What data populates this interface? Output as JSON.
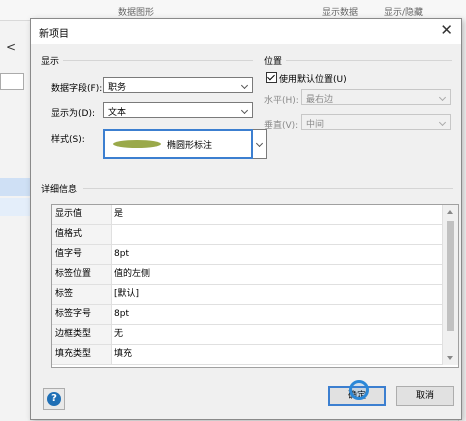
{
  "background": {
    "header_cols": [
      "数据图形",
      "显示数据",
      "显示/隐藏"
    ],
    "left_glyph": "<"
  },
  "dialog": {
    "title": "新项目",
    "close_glyph": "✕",
    "display_group": "显示",
    "data_field_label": "数据字段(F):",
    "data_field_value": "职务",
    "display_as_label": "显示为(D):",
    "display_as_value": "文本",
    "style_label": "样式(S):",
    "style_value": "椭圆形标注",
    "position_group": "位置",
    "use_default_position_label": "使用默认位置(U)",
    "use_default_position_checked": true,
    "horizontal_label": "水平(H):",
    "horizontal_value": "最右边",
    "vertical_label": "垂直(V):",
    "vertical_value": "中间",
    "details_group": "详细信息",
    "details": [
      {
        "key": "显示值",
        "value": "是"
      },
      {
        "key": "值格式",
        "value": ""
      },
      {
        "key": "值字号",
        "value": "8pt"
      },
      {
        "key": "标签位置",
        "value": "值的左侧"
      },
      {
        "key": "标签",
        "value": "[默认]"
      },
      {
        "key": "标签字号",
        "value": "8pt"
      },
      {
        "key": "边框类型",
        "value": "无"
      },
      {
        "key": "填充类型",
        "value": "填充"
      }
    ],
    "help_glyph": "?",
    "ok_label": "确定",
    "cancel_label": "取消"
  },
  "colors": {
    "accent": "#3c7fd0",
    "style_ellipse": "#9aa94a",
    "help_icon": "#1f6fb5"
  }
}
